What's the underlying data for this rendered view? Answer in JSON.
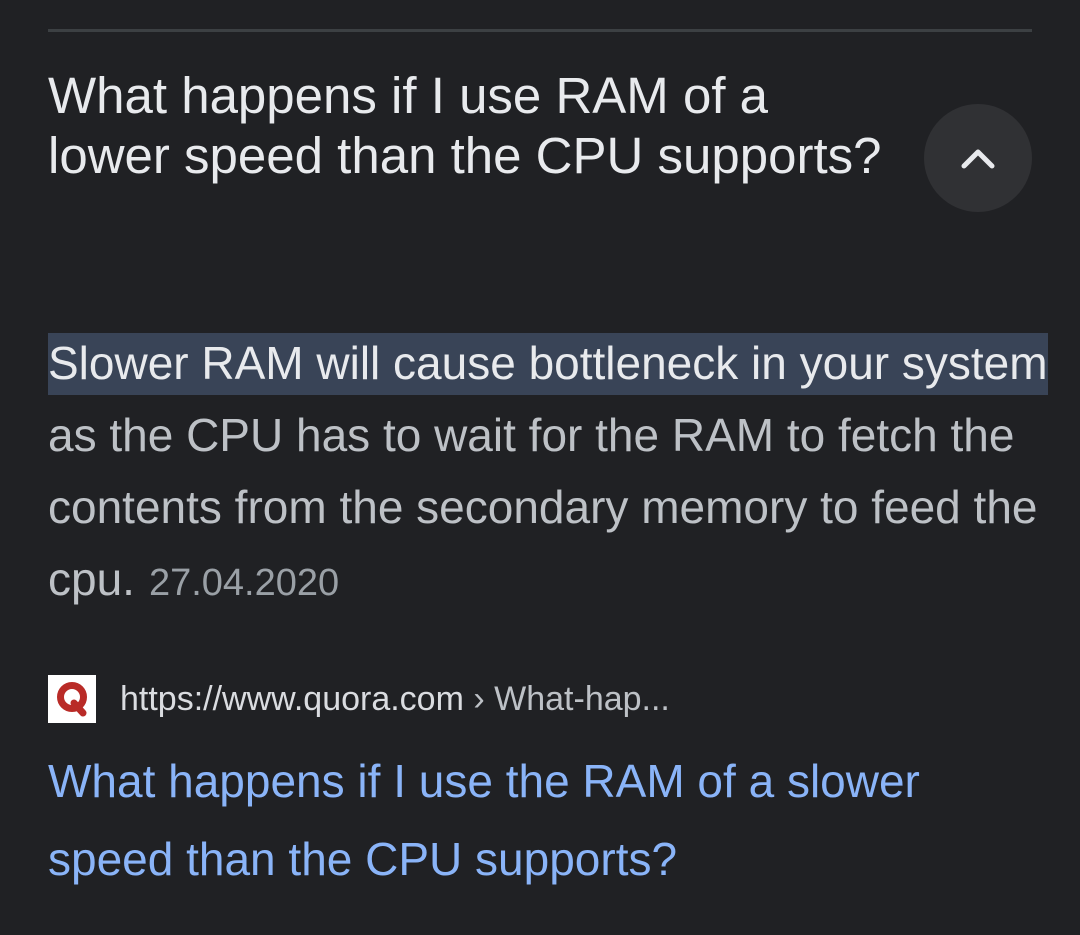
{
  "question": "What happens if I use RAM of a lower speed than the CPU supports?",
  "answer": {
    "highlight": "Slower RAM will cause bottleneck in your system",
    "rest": " as the CPU has to wait for the RAM to fetch the contents from the secondary memory to feed the cpu.",
    "date": "27.04.2020"
  },
  "source": {
    "favicon": "quora-favicon",
    "url": "https://www.quora.com",
    "crumb": " › What-hap...",
    "title": "What happens if I use the RAM of a slower speed than the CPU supports?"
  },
  "icons": {
    "collapse": "chevron-up-icon"
  },
  "colors": {
    "background": "#202124",
    "highlight": "#394457",
    "link": "#8ab4f8",
    "quora_red": "#b92b27"
  }
}
